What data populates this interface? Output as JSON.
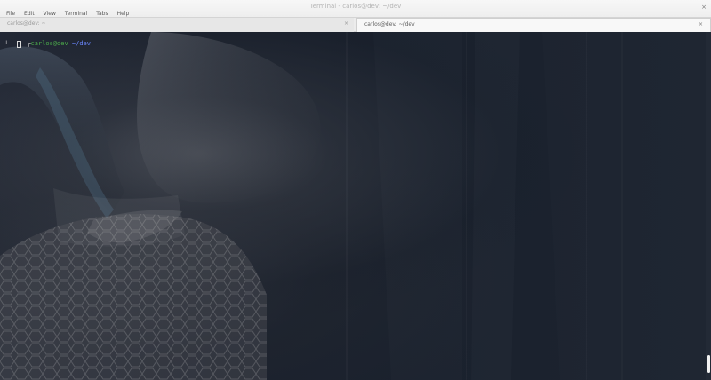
{
  "window": {
    "title": "Terminal - carlos@dev: ~/dev"
  },
  "menu": {
    "items": [
      "File",
      "Edit",
      "View",
      "Terminal",
      "Tabs",
      "Help"
    ]
  },
  "tabs": [
    {
      "label": "carlos@dev: ~"
    },
    {
      "label": "carlos@dev: ~/dev"
    }
  ],
  "terminal": {
    "prompt_open": "┌",
    "prompt_user": "carlos@dev",
    "prompt_path": "~/dev",
    "prompt_return": "└",
    "cursor_icon": "block-cursor-icon"
  },
  "colors": {
    "prompt_user": "#4ba94a",
    "prompt_path": "#6b87ff",
    "terminal_bg": "#1a202c"
  }
}
